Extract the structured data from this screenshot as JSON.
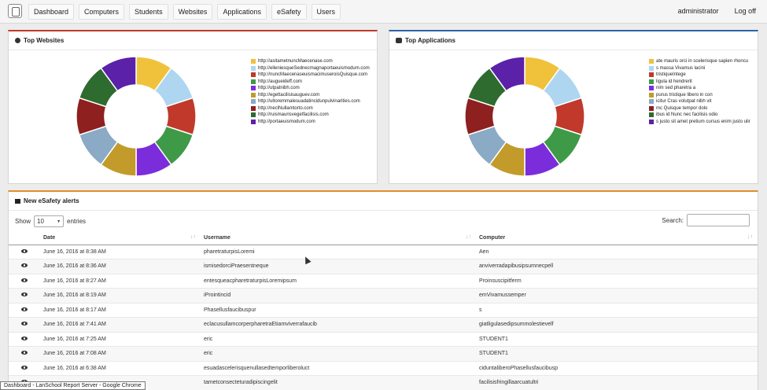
{
  "nav": {
    "items": [
      "Dashboard",
      "Computers",
      "Students",
      "Websites",
      "Applications",
      "eSafety",
      "Users"
    ],
    "user": "administrator",
    "logoff": "Log off"
  },
  "top_websites": {
    "title": "Top Websites",
    "icon": "globe-icon",
    "legend": [
      {
        "label": "http://asitametnuncMaecenase.com",
        "color": "#f0c23b"
      },
      {
        "label": "http://elleniesqueSednecmagnaportaeuismodum.com",
        "color": "#aed6f1"
      },
      {
        "label": "http://nuncMaecenaseuismacimuseroisQuisque.com",
        "color": "#c0392b"
      },
      {
        "label": "http://augueideff.com",
        "color": "#3e9a47"
      },
      {
        "label": "http://utpatnibh.com",
        "color": "#7b2ddb"
      },
      {
        "label": "http://egettacilisisauguev.com",
        "color": "#c29b2a"
      },
      {
        "label": "http://ultoremmalesuadatincidunpulvinarities.com",
        "color": "#8aaac5"
      },
      {
        "label": "http://neclNullamtorto.com",
        "color": "#8e2020"
      },
      {
        "label": "http://ruismaurisvegetfacilisis.com",
        "color": "#2e6b2e"
      },
      {
        "label": "http://portaeuismodum.com",
        "color": "#5b21a8"
      }
    ]
  },
  "top_applications": {
    "title": "Top Applications",
    "icon": "gears-icon",
    "legend": [
      {
        "label": "ate mauris orci in scelerisque sapien rhoncu",
        "color": "#f0c23b"
      },
      {
        "label": "s massa Vivamus lacini",
        "color": "#aed6f1"
      },
      {
        "label": "tristiqueIntege",
        "color": "#c0392b"
      },
      {
        "label": "ligula id hendrerit",
        "color": "#3e9a47"
      },
      {
        "label": "nim sed pharetra a",
        "color": "#7b2ddb"
      },
      {
        "label": "purus tristique libero in con",
        "color": "#c29b2a"
      },
      {
        "label": "icitur Cras volutpat nibh vit",
        "color": "#8aaac5"
      },
      {
        "label": "mc Quisque tempor dolo",
        "color": "#8e2020"
      },
      {
        "label": "ibus id Nunc nec facilisis odio",
        "color": "#2e6b2e"
      },
      {
        "label": "s justo sit amet pretium cursus enim justo ulir",
        "color": "#5b21a8"
      }
    ]
  },
  "alerts": {
    "title": "New eSafety alerts",
    "show_label": "Show",
    "entries_value": "10",
    "entries_label": "entries",
    "search_label": "Search:",
    "columns": [
      "Date",
      "Username",
      "Computer"
    ],
    "rows": [
      {
        "date": "June 16, 2016 at 8:38 AM",
        "username": "pharetraturpisLoremi",
        "computer": "Aen"
      },
      {
        "date": "June 16, 2016 at 8:36 AM",
        "username": "ismisedorciPraesentneque",
        "computer": "anviverradapibusipsumnecpell"
      },
      {
        "date": "June 16, 2016 at 8:27 AM",
        "username": "entesqueacpharetraturpisLoremipsum",
        "computer": "Proinsuscipitferm"
      },
      {
        "date": "June 16, 2016 at 8:19 AM",
        "username": "iProintincid",
        "computer": "emVivamussemper"
      },
      {
        "date": "June 16, 2016 at 8:17 AM",
        "username": "Phasellusfaucibuspur",
        "computer": "s"
      },
      {
        "date": "June 16, 2016 at 7:41 AM",
        "username": "eclacusullamcorperpharetraEtiamviverrafaucib",
        "computer": "giatligulasedipsummolestievelf"
      },
      {
        "date": "June 16, 2016 at 7:25 AM",
        "username": "eric",
        "computer": "STUDENT1"
      },
      {
        "date": "June 16, 2016 at 7:08 AM",
        "username": "eric",
        "computer": "STUDENT1"
      },
      {
        "date": "June 16, 2016 at 6:38 AM",
        "username": "esuadascelerisquenullasedtemporliberoluct",
        "computer": "ciduntaliberoPhasellusfaucibusp"
      },
      {
        "date": "",
        "username": "tametconsecteturadipiscingelit",
        "computer": "facilisisfringillaarcuatultri"
      }
    ]
  },
  "tooltip": "Dashboard - LanSchool Report Server - Google Chrome",
  "chart_data": [
    {
      "type": "pie",
      "title": "Top Websites",
      "labels": [
        "http://asitametnuncMaecenase.com",
        "http://elleniesqueSednecmagnaportaeuismodum.com",
        "http://nuncMaecenaseuismacimuseroisQuisque.com",
        "http://augueideff.com",
        "http://utpatnibh.com",
        "http://egettacilisisauguev.com",
        "http://ultoremmalesuadatincidunpulvinarities.com",
        "http://neclNullamtorto.com",
        "http://ruismaurisvegetfacilisis.com",
        "http://portaeuismodum.com"
      ],
      "values": [
        10,
        10,
        10,
        10,
        10,
        10,
        10,
        10,
        10,
        10
      ],
      "colors": [
        "#f0c23b",
        "#aed6f1",
        "#c0392b",
        "#3e9a47",
        "#7b2ddb",
        "#c29b2a",
        "#8aaac5",
        "#8e2020",
        "#2e6b2e",
        "#5b21a8"
      ],
      "legend": "right"
    },
    {
      "type": "pie",
      "title": "Top Applications",
      "labels": [
        "ate mauris orci in scelerisque sapien rhoncu",
        "s massa Vivamus lacini",
        "tristiqueIntege",
        "ligula id hendrerit",
        "nim sed pharetra a",
        "purus tristique libero in con",
        "icitur Cras volutpat nibh vit",
        "mc Quisque tempor dolo",
        "ibus id Nunc nec facilisis odio",
        "s justo sit amet pretium cursus enim justo ulir"
      ],
      "values": [
        10,
        10,
        10,
        10,
        10,
        10,
        10,
        10,
        10,
        10
      ],
      "colors": [
        "#f0c23b",
        "#aed6f1",
        "#c0392b",
        "#3e9a47",
        "#7b2ddb",
        "#c29b2a",
        "#8aaac5",
        "#8e2020",
        "#2e6b2e",
        "#5b21a8"
      ],
      "legend": "right"
    }
  ]
}
